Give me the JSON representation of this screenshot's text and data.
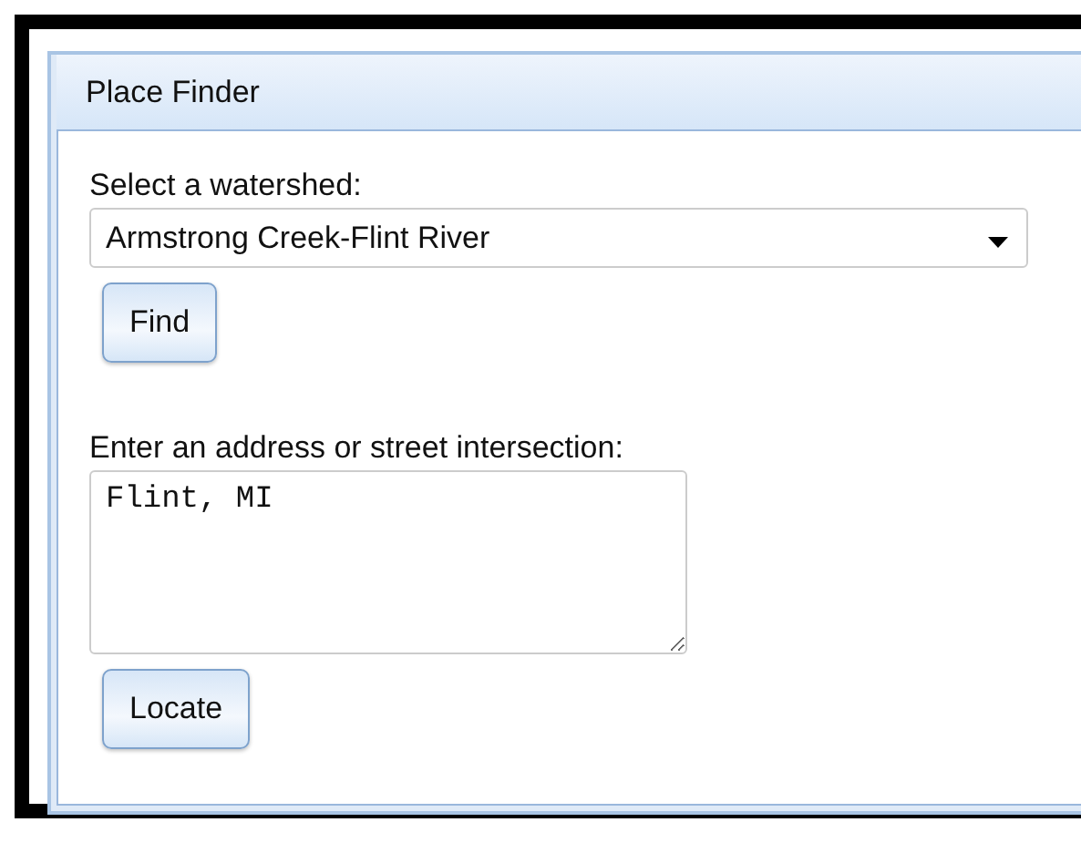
{
  "panel": {
    "title": "Place Finder"
  },
  "watershed": {
    "label": "Select a watershed:",
    "value": "Armstrong Creek-Flint River",
    "button": "Find"
  },
  "address": {
    "label": "Enter an address or street intersection:",
    "value": "Flint, MI",
    "button": "Locate"
  }
}
